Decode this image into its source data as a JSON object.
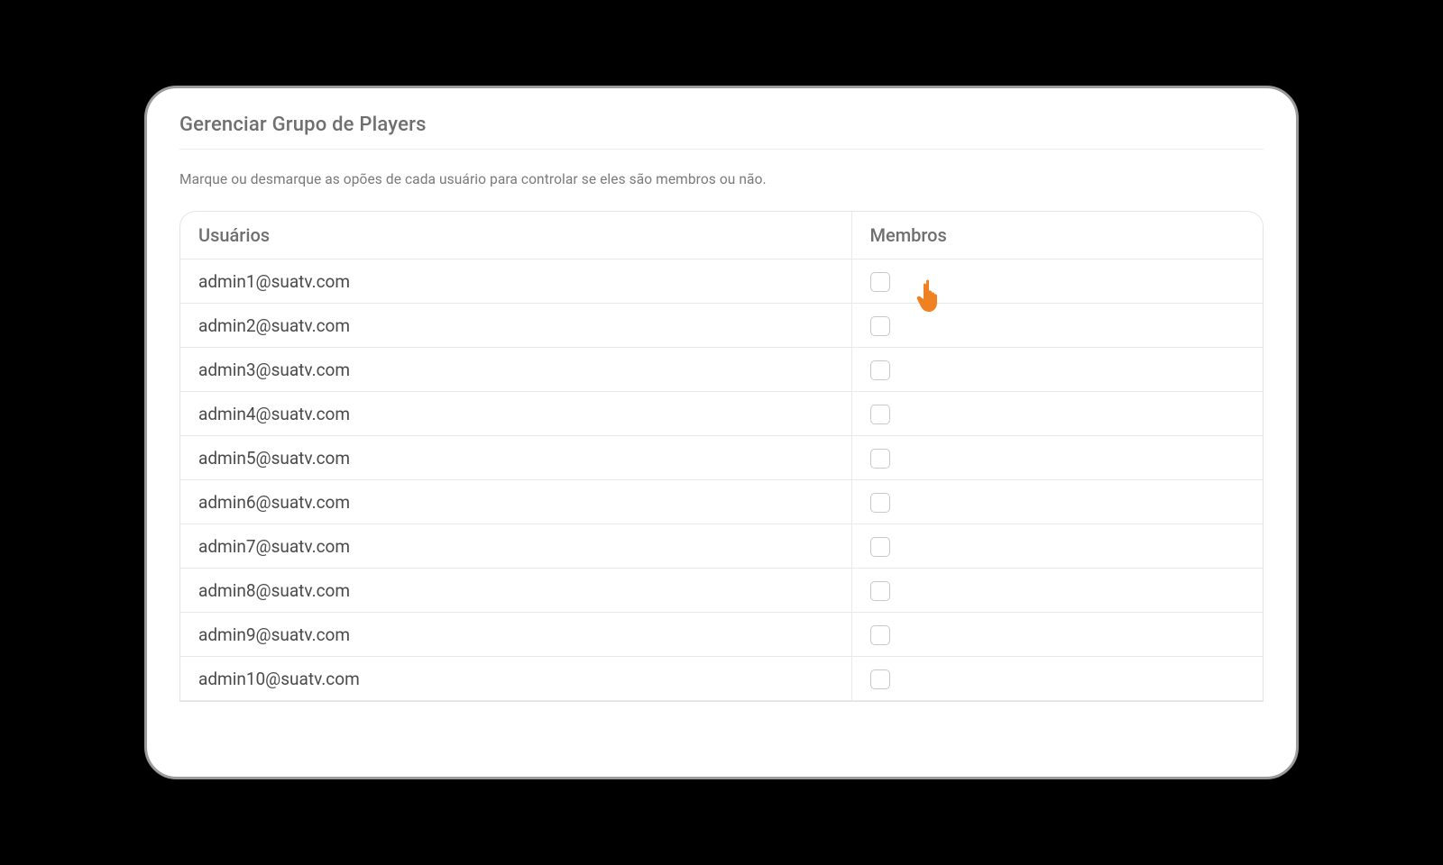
{
  "header": {
    "title": "Gerenciar Grupo de Players",
    "instruction": "Marque ou desmarque as opões de cada usuário para controlar se eles são membros ou não."
  },
  "table": {
    "columns": {
      "users": "Usuários",
      "members": "Membros"
    },
    "rows": [
      {
        "email": "admin1@suatv.com",
        "member": false
      },
      {
        "email": "admin2@suatv.com",
        "member": false
      },
      {
        "email": "admin3@suatv.com",
        "member": false
      },
      {
        "email": "admin4@suatv.com",
        "member": false
      },
      {
        "email": "admin5@suatv.com",
        "member": false
      },
      {
        "email": "admin6@suatv.com",
        "member": false
      },
      {
        "email": "admin7@suatv.com",
        "member": false
      },
      {
        "email": "admin8@suatv.com",
        "member": false
      },
      {
        "email": "admin9@suatv.com",
        "member": false
      },
      {
        "email": "admin10@suatv.com",
        "member": false
      }
    ]
  },
  "cursor": {
    "icon": "hand-pointer-icon",
    "color": "#ef8122"
  }
}
